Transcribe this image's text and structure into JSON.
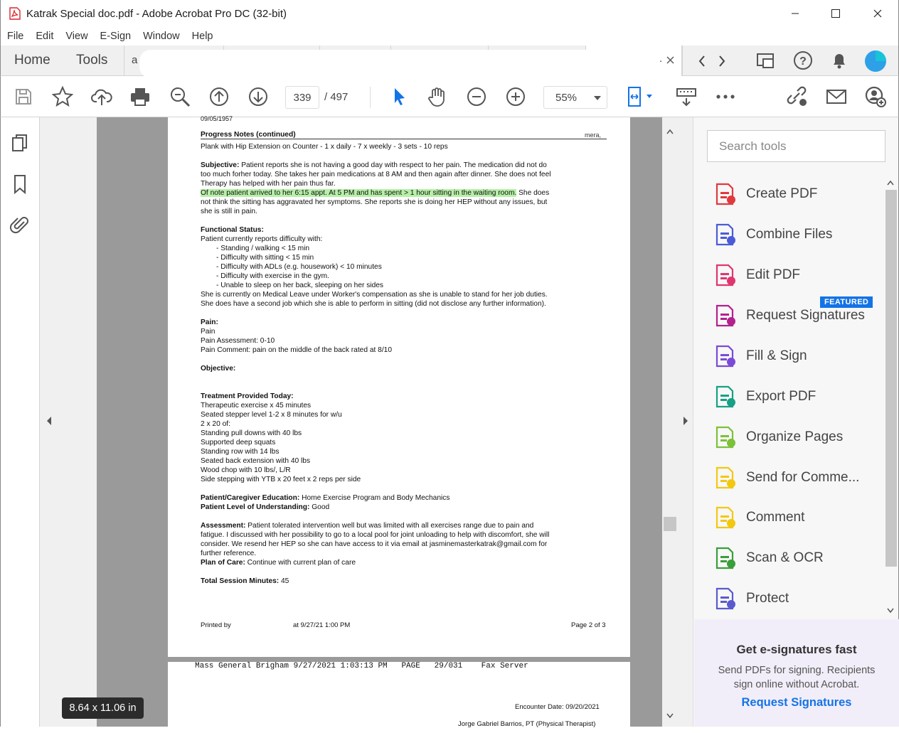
{
  "window": {
    "title": "Katrak Special doc.pdf - Adobe Acrobat Pro DC (32-bit)"
  },
  "menu": [
    "File",
    "Edit",
    "View",
    "E-Sign",
    "Window",
    "Help"
  ],
  "tabs": {
    "home": "Home",
    "tools": "Tools",
    "doc_tab_fragment": "a",
    "doc_tab_ellipsis": "."
  },
  "toolbar": {
    "page_current": "339",
    "page_total": "/ 497",
    "zoom": "55%"
  },
  "doc_page1": [
    {
      "text": "09/05/1957"
    },
    {
      "text": "Progress Notes (continued)",
      "bold": true
    },
    {
      "text": "Plank with Hip Extension on Counter - 1 x daily - 7 x weekly - 3 sets - 10 reps"
    },
    {
      "text": ""
    },
    {
      "text": "Subjective: Patient reports she is not having a good day with respect to her pain.  The medication did not do",
      "boldlead": "Subjective:"
    },
    {
      "text": "too much forher today.  She takes her pain medications at 8 AM and then again after dinner.  She does not feel"
    },
    {
      "text": "Therapy has helped with her pain thus far."
    },
    {
      "text": "Of note patient arrived to her 6:15 appt. At 5 PM and has spent > 1 hour sitting in the waiting room.",
      "highlight": true,
      "tail": " She does"
    },
    {
      "text": "not think the sitting has aggravated her symptoms.  She reports she is doing her HEP without any issues, but"
    },
    {
      "text": "she is still in pain."
    },
    {
      "text": ""
    },
    {
      "text": "Functional Status:",
      "bold": true
    },
    {
      "text": "Patient currently reports difficulty with:"
    },
    {
      "text": "-        Standing / walking < 15 min",
      "indent": true
    },
    {
      "text": "-        Difficulty with sitting < 15 min",
      "indent": true
    },
    {
      "text": "-        Difficulty with ADLs (e.g. housework) < 10 minutes",
      "indent": true
    },
    {
      "text": "-        Difficulty with exercise in the gym.",
      "indent": true
    },
    {
      "text": "-        Unable to sleep on her back, sleeping on her sides",
      "indent": true
    },
    {
      "text": "She is currently on Medical Leave under Worker's compensation as she is unable to stand for her job duties."
    },
    {
      "text": "She does have a second job which she is able to perform in sitting (did not disclose any further information)."
    },
    {
      "text": ""
    },
    {
      "text": "Pain:",
      "bold": true
    },
    {
      "text": "Pain"
    },
    {
      "text": "Pain Assessment: 0-10"
    },
    {
      "text": "Pain Comment: pain on the middle of the back rated at 8/10"
    },
    {
      "text": ""
    },
    {
      "text": "Objective:",
      "bold": true
    },
    {
      "text": ""
    },
    {
      "text": ""
    },
    {
      "text": "Treatment Provided Today:",
      "bold": true
    },
    {
      "text": "Therapeutic exercise x 45 minutes"
    },
    {
      "text": "Seated stepper level 1-2 x 8 minutes for w/u"
    },
    {
      "text": "2 x 20 of:"
    },
    {
      "text": "Standing pull downs with 40 lbs"
    },
    {
      "text": "Supported deep squats"
    },
    {
      "text": "Standing row with 14 lbs"
    },
    {
      "text": "Seated back extension with 40 lbs"
    },
    {
      "text": "Wood chop with 10 lbs/, L/R"
    },
    {
      "text": "Side stepping with YTB x 20 feet x 2 reps per side"
    },
    {
      "text": ""
    },
    {
      "text": "Patient/Caregiver Education:  Home Exercise Program and Body Mechanics",
      "boldlead": "Patient/Caregiver Education:"
    },
    {
      "text": "Patient Level of Understanding: Good",
      "boldlead": "Patient Level of Understanding:"
    },
    {
      "text": ""
    },
    {
      "text": "Assessment: Patient tolerated intervention well but was limited with all exercises range due to pain and",
      "boldlead": "Assessment:"
    },
    {
      "text": "fatigue.  I discussed with her possibility to go to a local pool for joint unloading to help with discomfort, she will"
    },
    {
      "text": "consider.  We resend her HEP so she can have access to it via email at jasminemasterkatrak@gmail.com for"
    },
    {
      "text": "further reference."
    },
    {
      "text": "Plan of Care: Continue with current plan of care",
      "boldlead": "Plan of Care:"
    },
    {
      "text": ""
    },
    {
      "text": "Total Session Minutes: 45",
      "boldlead": "Total Session Minutes:"
    }
  ],
  "doc_footer": {
    "printed_by": "Printed by",
    "printed_at": "at 9/27/21  1:00 PM",
    "page": "Page 2 of 3",
    "header_right": "mera,"
  },
  "doc_page2": {
    "fax_header": "Mass General Brigham 9/27/2021 1:03:13 PM   PAGE   29/031    Fax Server",
    "encounter": "Encounter Date: 09/20/2021",
    "therapist": "Jorge Gabriel Barrios, PT (Physical Therapist)"
  },
  "size_badge": "8.64 x 11.06 in",
  "right_pane": {
    "search_placeholder": "Search tools",
    "featured_badge": "FEATURED",
    "tools": [
      {
        "label": "Create PDF",
        "icon": "create-pdf-icon",
        "color": "#e03a3e"
      },
      {
        "label": "Combine Files",
        "icon": "combine-files-icon",
        "color": "#4b5bd8"
      },
      {
        "label": "Edit PDF",
        "icon": "edit-pdf-icon",
        "color": "#e0366f"
      },
      {
        "label": "Request Signatures",
        "icon": "request-signatures-icon",
        "color": "#b3218e"
      },
      {
        "label": "Fill & Sign",
        "icon": "fill-sign-icon",
        "color": "#7a4bd8"
      },
      {
        "label": "Export PDF",
        "icon": "export-pdf-icon",
        "color": "#17a086"
      },
      {
        "label": "Organize Pages",
        "icon": "organize-pages-icon",
        "color": "#7cc13a"
      },
      {
        "label": "Send for Comme...",
        "icon": "send-comments-icon",
        "color": "#f2c811"
      },
      {
        "label": "Comment",
        "icon": "comment-icon",
        "color": "#f2c811"
      },
      {
        "label": "Scan & OCR",
        "icon": "scan-ocr-icon",
        "color": "#3a9e3a"
      },
      {
        "label": "Protect",
        "icon": "protect-icon",
        "color": "#5a5ad0"
      }
    ],
    "promo": {
      "title": "Get e-signatures fast",
      "text": "Send PDFs for signing. Recipients sign online without Acrobat.",
      "link": "Request Signatures"
    }
  }
}
